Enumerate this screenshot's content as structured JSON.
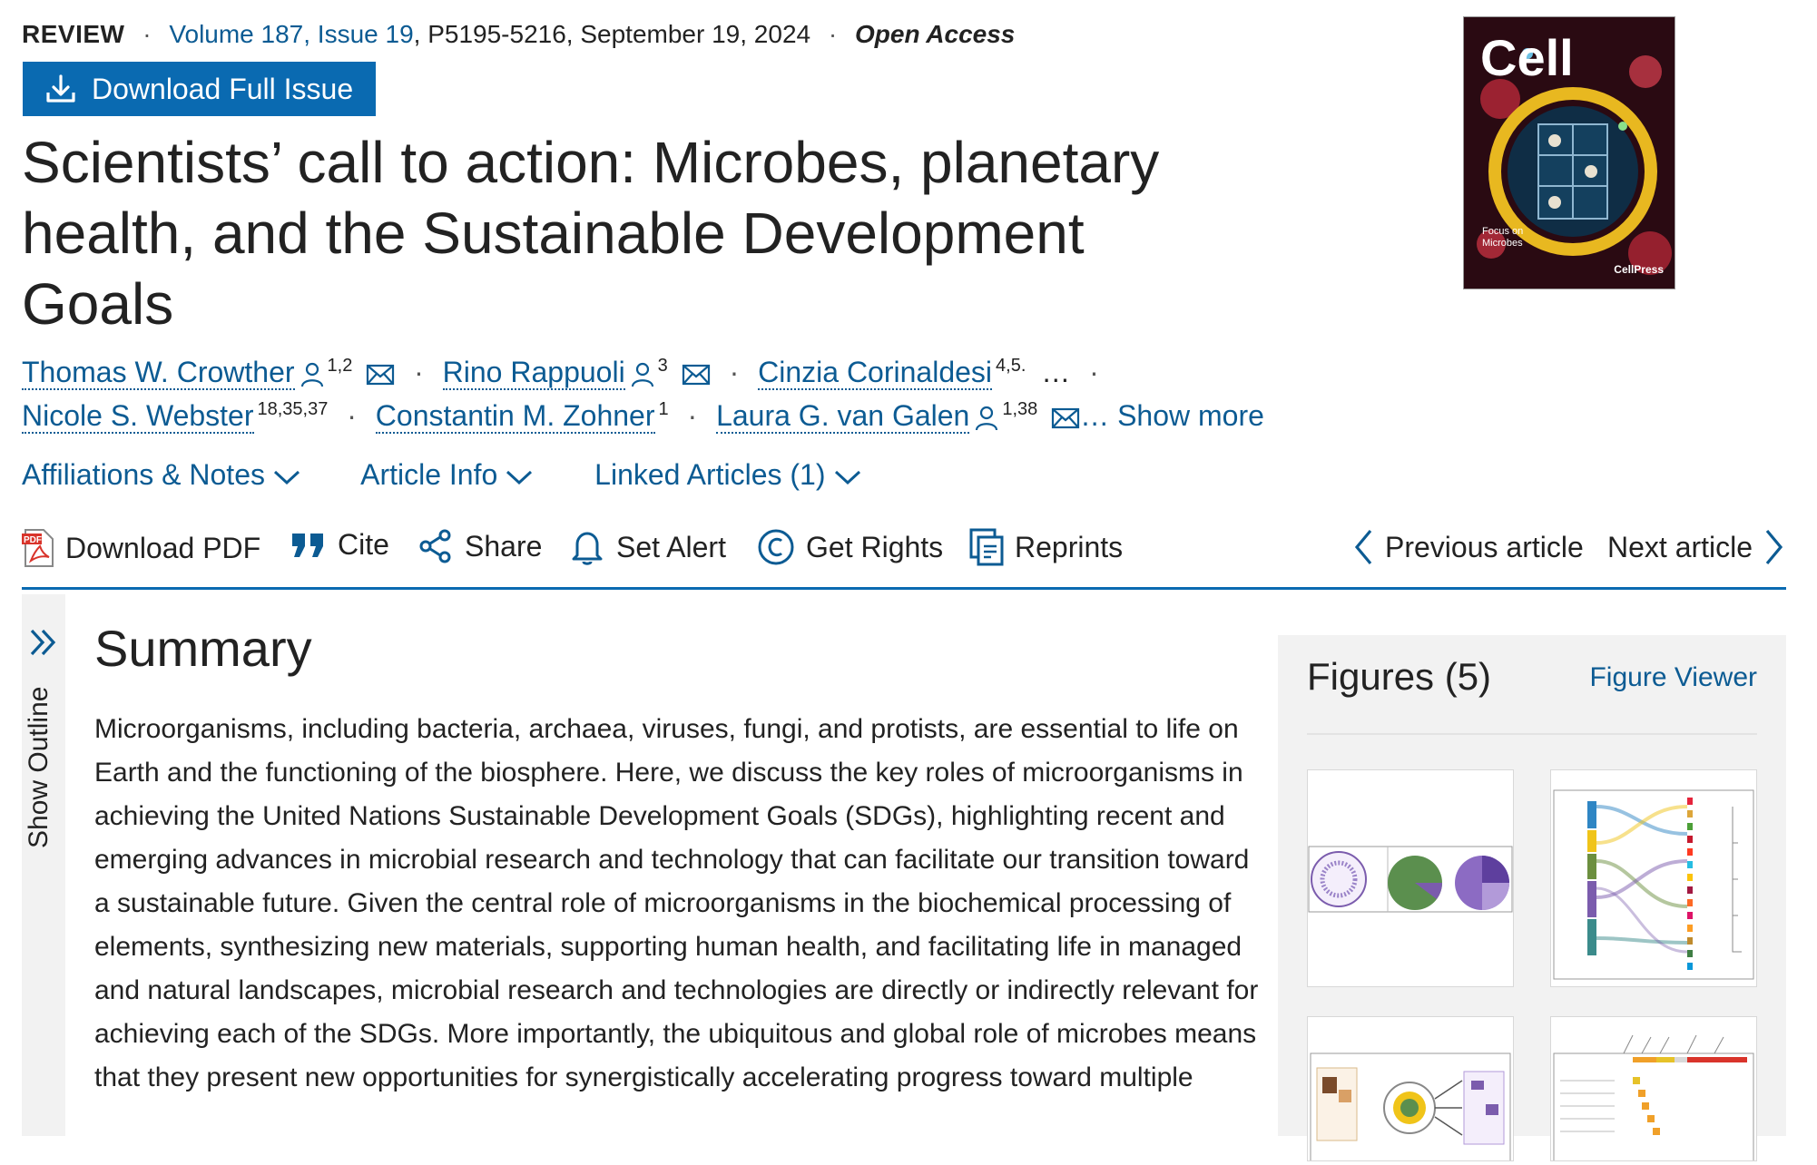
{
  "meta": {
    "type": "REVIEW",
    "volume_issue": "Volume 187, Issue 19",
    "pages_date": ", P5195-5216, September 19, 2024",
    "access": "Open Access",
    "dot": "·"
  },
  "download_issue": {
    "label": "Download Full Issue",
    "icon": "download-icon"
  },
  "cover": {
    "journal": "Cell",
    "caption": "Focus on Microbes",
    "publisher": "CellPress"
  },
  "title": "Scientists’ call to action: Microbes, planetary health, and the Sustainable Development Goals",
  "authors": {
    "a1": {
      "name": "Thomas W. Crowther",
      "sup": "1,2"
    },
    "a2": {
      "name": "Rino Rappuoli",
      "sup": "3"
    },
    "a3": {
      "name": "Cinzia Corinaldesi",
      "sup": "4,5."
    },
    "a4": {
      "name": "Nicole S. Webster",
      "sup": "18,35,37"
    },
    "a5": {
      "name": "Constantin M. Zohner",
      "sup": "1"
    },
    "a6": {
      "name": "Laura G. van Galen",
      "sup": "1,38"
    },
    "ellipsis": "…",
    "show_more": "… Show more"
  },
  "meta_tabs": {
    "affiliations": "Affiliations & Notes",
    "article_info": "Article Info",
    "linked": "Linked Articles (1)"
  },
  "toolbar": {
    "download_pdf": "Download PDF",
    "cite": "Cite",
    "share": "Share",
    "set_alert": "Set Alert",
    "get_rights": "Get Rights",
    "reprints": "Reprints",
    "previous": "Previous article",
    "next": "Next article"
  },
  "outline": {
    "label": "Show Outline"
  },
  "summary": {
    "heading": "Summary",
    "text": "Microorganisms, including bacteria, archaea, viruses, fungi, and protists, are essential to life on Earth and the functioning of the biosphere. Here, we discuss the key roles of microorganisms in achieving the United Nations Sustainable Development Goals (SDGs), highlighting recent and emerging advances in microbial research and technology that can facilitate our transition toward a sustainable future. Given the central role of microorganisms in the biochemical processing of elements, synthesizing new materials, supporting human health, and facilitating life in managed and natural landscapes, microbial research and technologies are directly or indirectly relevant for achieving each of the SDGs. More importantly, the ubiquitous and global role of microbes means that they present new opportunities for synergistically accelerating progress toward multiple"
  },
  "figures": {
    "title": "Figures (5)",
    "viewer": "Figure Viewer",
    "accent_colors": [
      "#5b8f4e",
      "#7b5cad",
      "#e0412c",
      "#f0a029",
      "#2f86c4"
    ]
  }
}
